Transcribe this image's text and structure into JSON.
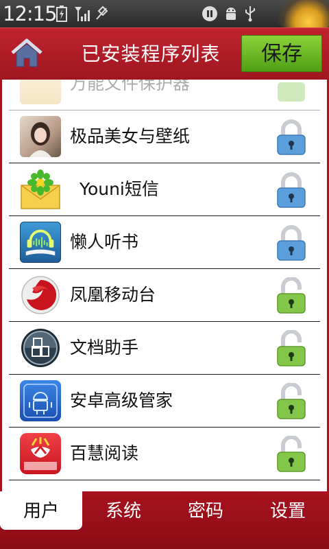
{
  "status_bar": {
    "time": "12:15",
    "icons": [
      "battery-icon",
      "signal-icon",
      "no-gps-icon",
      "pause-icon",
      "android-icon",
      "usb-icon"
    ]
  },
  "header": {
    "title": "已安装程序列表",
    "save_label": "保存",
    "home_icon": "home-icon"
  },
  "apps": [
    {
      "name": "万能文件保护器",
      "icon": "file-protector-icon",
      "locked": true,
      "partially_visible": true
    },
    {
      "name": "极品美女与壁纸",
      "icon": "wallpaper-girl-icon",
      "locked": true
    },
    {
      "name": "Youni短信",
      "icon": "youni-sms-icon",
      "locked": true
    },
    {
      "name": "懒人听书",
      "icon": "audiobook-icon",
      "locked": true
    },
    {
      "name": "凤凰移动台",
      "icon": "phoenix-icon",
      "locked": false
    },
    {
      "name": "文档助手",
      "icon": "document-helper-icon",
      "locked": false
    },
    {
      "name": "安卓高级管家",
      "icon": "android-manager-icon",
      "locked": false
    },
    {
      "name": "百慧阅读",
      "icon": "baihui-reader-icon",
      "locked": false
    }
  ],
  "tabs": [
    {
      "label": "用户",
      "active": true
    },
    {
      "label": "系统",
      "active": false
    },
    {
      "label": "密码",
      "active": false
    },
    {
      "label": "设置",
      "active": false
    }
  ],
  "colors": {
    "brand_red": "#a8121e",
    "save_green": "#6cbb22",
    "lock_blue": "#4f9ad8",
    "lock_green": "#7cc243"
  }
}
